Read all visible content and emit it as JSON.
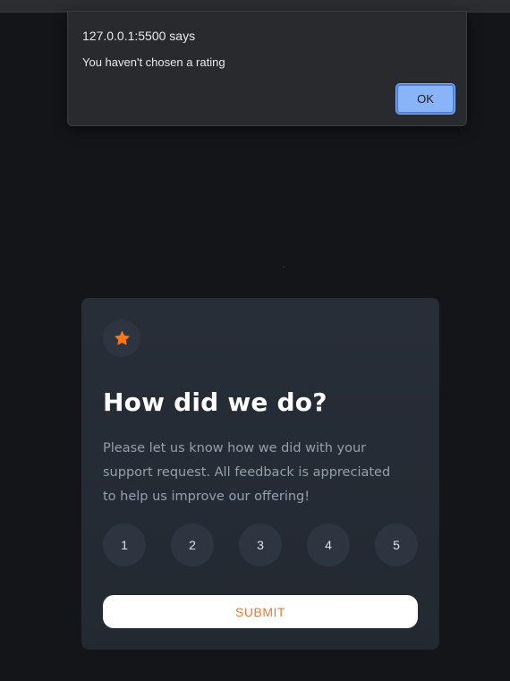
{
  "dialog": {
    "title": "127.0.0.1:5500 says",
    "message": "You haven't chosen a rating",
    "ok_label": "OK"
  },
  "card": {
    "icon": "star-icon",
    "title": "How did we do?",
    "description": "Please let us know how we did with your support request. All feedback is appreciated to help us improve our offering!",
    "ratings": [
      "1",
      "2",
      "3",
      "4",
      "5"
    ],
    "submit_label": "SUBMIT"
  },
  "colors": {
    "page_bg": "#131518",
    "card_bg": "#252d37",
    "accent_orange": "#fc7614",
    "muted_text": "#969fad",
    "dialog_bg": "#292a2d",
    "ok_button": "#8ab4f8"
  }
}
